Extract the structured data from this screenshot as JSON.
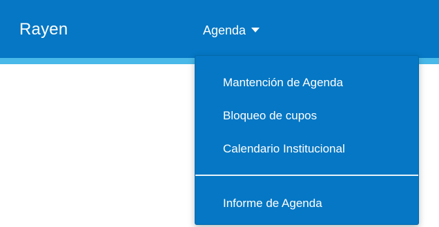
{
  "navbar": {
    "brand": "Rayen",
    "menu_toggle_label": "Agenda",
    "color": "#0577c4",
    "accent_color": "#49b9e9"
  },
  "dropdown": {
    "items": [
      {
        "label": "Mantención de Agenda"
      },
      {
        "label": "Bloqueo de cupos"
      },
      {
        "label": "Calendario Institucional"
      },
      {
        "label": "Informe de Agenda"
      }
    ]
  }
}
